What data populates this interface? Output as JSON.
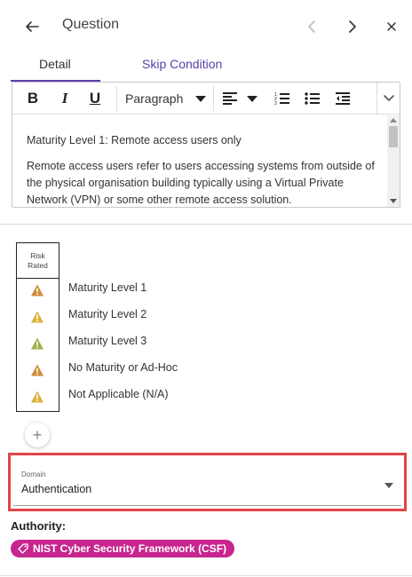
{
  "header": {
    "title": "Question",
    "back_icon": "arrow-left-icon",
    "prev_icon": "chevron-left-icon",
    "next_icon": "chevron-right-icon",
    "close_icon": "close-icon"
  },
  "tabs": [
    {
      "label": "Detail",
      "active": true
    },
    {
      "label": "Skip Condition",
      "active": false
    }
  ],
  "toolbar": {
    "bold_label": "B",
    "italic_label": "I",
    "underline_label": "U",
    "paragraph_select": "Paragraph",
    "icons": [
      "align-left-icon",
      "numbered-list-icon",
      "bulleted-list-icon",
      "outdent-icon",
      "chevron-down-icon"
    ]
  },
  "editor": {
    "paragraphs": [
      "Maturity Level 1: Remote access users only",
      "Remote access users refer to users accessing systems from outside of the physical organisation building typically using a Virtual Private Network (VPN) or some other remote access solution."
    ]
  },
  "risk": {
    "header_line1": "Risk",
    "header_line2": "Rated",
    "rows": [
      {
        "label": "Maturity Level 1",
        "color": "#d08a3a"
      },
      {
        "label": "Maturity Level 2",
        "color": "#d9b43c"
      },
      {
        "label": "Maturity Level 3",
        "color": "#9bb04a"
      },
      {
        "label": "No Maturity or Ad-Hoc",
        "color": "#d08a3a"
      },
      {
        "label": "Not Applicable (N/A)",
        "color": "#d9b43c"
      }
    ]
  },
  "add_button": "+",
  "domain": {
    "label": "Domain",
    "value": "Authentication",
    "highlight_color": "#e04449"
  },
  "authority": {
    "label": "Authority:",
    "chip": "NIST Cyber Security Framework (CSF)",
    "chip_color": "#c8258f"
  },
  "colors": {
    "accent": "#5b3fa8"
  }
}
